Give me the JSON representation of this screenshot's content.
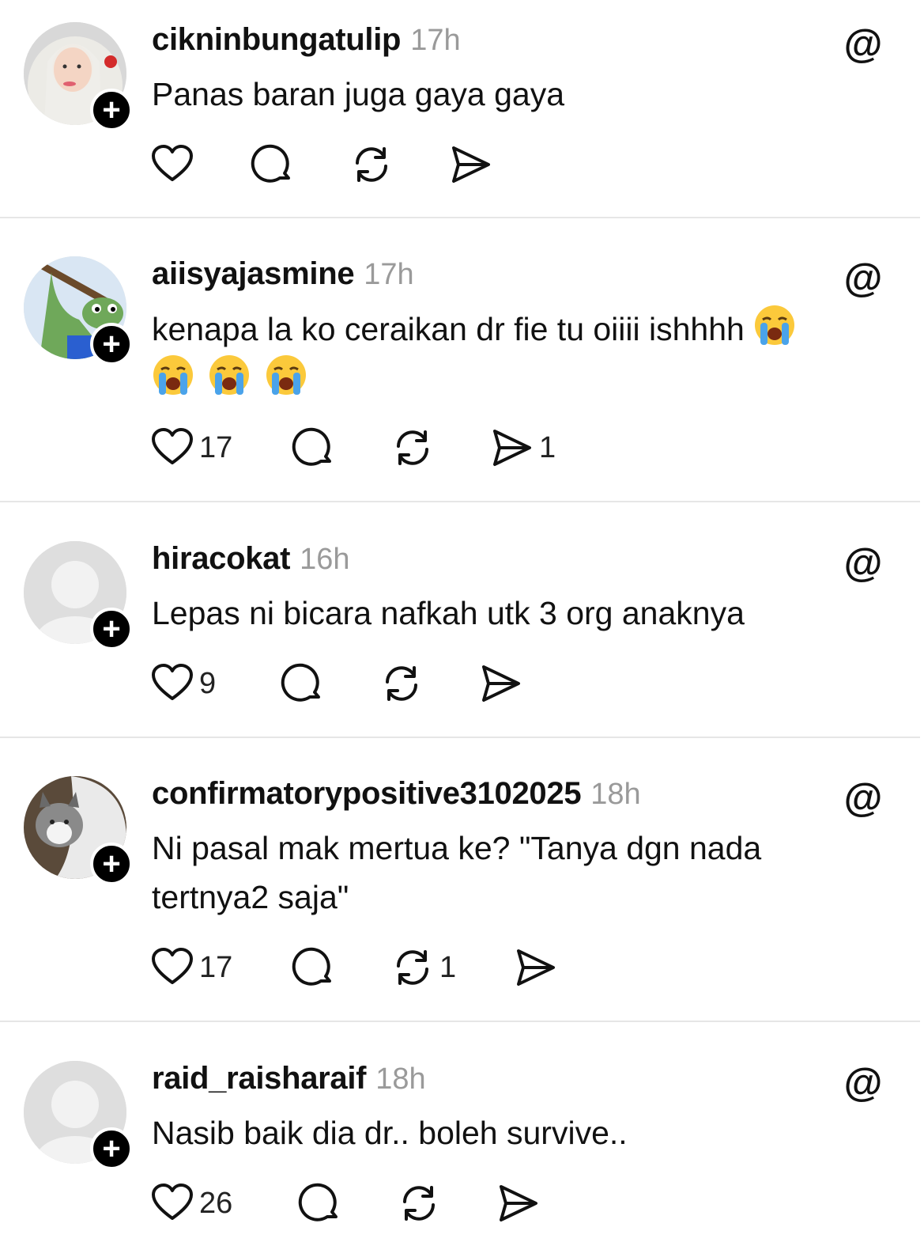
{
  "posts": [
    {
      "username": "cikninbungatulip",
      "time": "17h",
      "text": "Panas baran juga gaya gaya",
      "emojis": [],
      "likes": "",
      "comments": "",
      "reposts": "",
      "shares": "",
      "avatar": "hijab-woman"
    },
    {
      "username": "aiisyajasmine",
      "time": "17h",
      "text": "kenapa la ko ceraikan dr fie tu oiiii ishhhh",
      "emojis": [
        "loudly-crying-face",
        "loudly-crying-face",
        "loudly-crying-face",
        "loudly-crying-face"
      ],
      "likes": "17",
      "comments": "",
      "reposts": "",
      "shares": "1",
      "avatar": "frog-cartoon"
    },
    {
      "username": "hiracokat",
      "time": "16h",
      "text": "Lepas ni bicara nafkah utk 3 org anaknya",
      "emojis": [],
      "likes": "9",
      "comments": "",
      "reposts": "",
      "shares": "",
      "avatar": "default-placeholder"
    },
    {
      "username": "confirmatorypositive3102025",
      "time": "18h",
      "text": "Ni pasal mak mertua ke? \"Tanya dgn nada tertnya2 saja\"",
      "emojis": [],
      "likes": "17",
      "comments": "",
      "reposts": "1",
      "shares": "",
      "avatar": "cat-photo"
    },
    {
      "username": "raid_raisharaif",
      "time": "18h",
      "text": "Nasib baik dia dr.. boleh survive..",
      "emojis": [],
      "likes": "26",
      "comments": "",
      "reposts": "",
      "shares": "",
      "avatar": "default-placeholder"
    }
  ],
  "colors": {
    "text": "#111111",
    "muted": "#9a9a9a",
    "divider": "#e6e6e6",
    "follow_badge": "#000000"
  },
  "icons": [
    "heart-icon",
    "comment-icon",
    "repost-icon",
    "share-icon",
    "threads-logo-icon",
    "follow-plus-icon"
  ]
}
